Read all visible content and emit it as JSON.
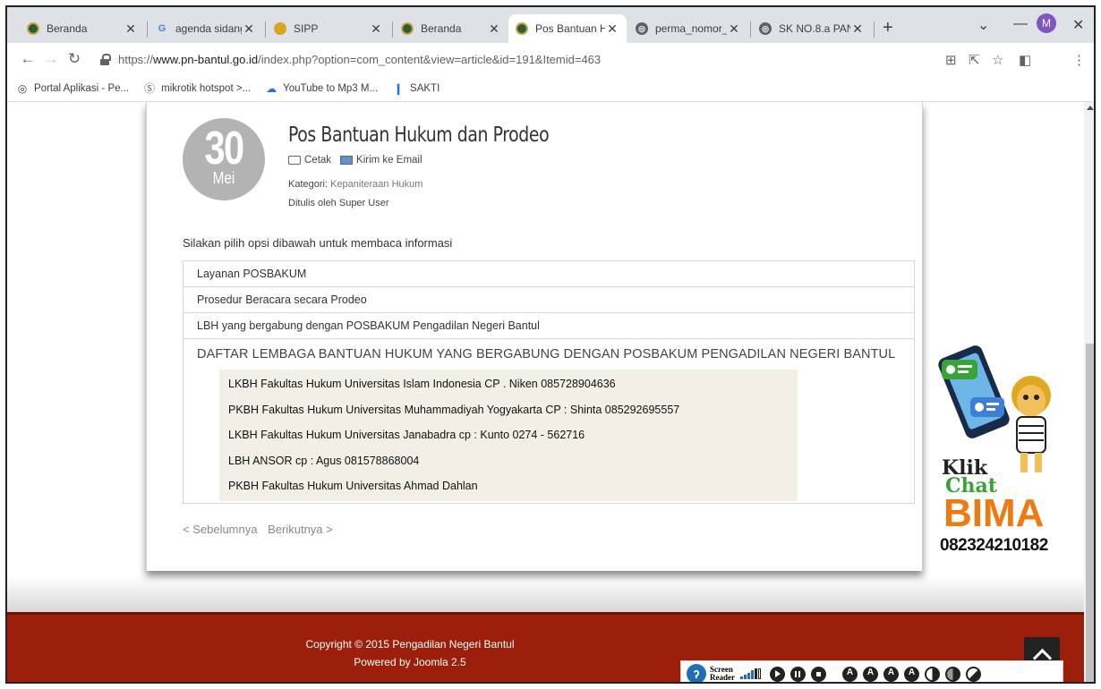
{
  "browser": {
    "tabs": [
      {
        "title": "Beranda",
        "favicon": "court-logo-icon"
      },
      {
        "title": "agenda sidang",
        "favicon": "google-icon"
      },
      {
        "title": "SIPP",
        "favicon": "sipp-logo-icon"
      },
      {
        "title": "Beranda",
        "favicon": "court-logo-icon"
      },
      {
        "title": "Pos Bantuan H",
        "favicon": "court-logo-icon",
        "active": true
      },
      {
        "title": "perma_nomor_",
        "favicon": "globe-icon"
      },
      {
        "title": "SK NO.8.a PAN",
        "favicon": "globe-icon"
      }
    ],
    "url_scheme": "https://",
    "url_host": "www.pn-bantul.go.id",
    "url_path": "/index.php?option=com_content&view=article&id=191&Itemid=463",
    "profile_initial": "M",
    "bookmarks": [
      {
        "label": "Portal Aplikasi - Pe...",
        "icon": "globe-icon"
      },
      {
        "label": "mikrotik hotspot >...",
        "icon": "mikrotik-icon"
      },
      {
        "label": "YouTube to Mp3 M...",
        "icon": "cloud-download-icon"
      },
      {
        "label": "SAKTI",
        "icon": "sakti-icon"
      }
    ]
  },
  "article": {
    "date_day": "30",
    "date_month": "Mei",
    "title": "Pos Bantuan Hukum dan Prodeo",
    "print_label": "Cetak",
    "email_label": "Kirim ke Email",
    "category_label": "Kategori:",
    "category_value": "Kepaniteraan Hukum",
    "author_text": "Ditulis oleh Super User",
    "intro": "Silakan pilih opsi dibawah untuk membaca informasi",
    "accordion": [
      "Layanan POSBAKUM",
      "Prosedur Beracara secara Prodeo",
      "LBH yang bergabung dengan POSBAKUM Pengadilan Negeri Bantul"
    ],
    "open_section_title": "DAFTAR LEMBAGA BANTUAN HUKUM YANG BERGABUNG DENGAN POSBAKUM PENGADILAN NEGERI BANTUL",
    "open_section_items": [
      "LKBH Fakultas Hukum Universitas Islam Indonesia CP . Niken 085728904636",
      "PKBH Fakultas Hukum Universitas Muhammadiyah Yogyakarta CP : Shinta 085292695557",
      "LKBH Fakultas Hukum Universitas Janabadra cp : Kunto 0274 - 562716",
      "LBH ANSOR cp : Agus 081578868004",
      "PKBH Fakultas Hukum Universitas Ahmad Dahlan"
    ],
    "prev_label": "< Sebelumnya",
    "next_label": "Berikutnya >"
  },
  "footer": {
    "copyright": "Copyright © 2015 Pengadilan Negeri Bantul",
    "powered": "Powered by Joomla 2.5"
  },
  "chat_widget": {
    "line1": "Klik",
    "line2": "Chat",
    "line3": "BIMA",
    "phone": "082324210182"
  },
  "screen_reader": {
    "label": "Screen Reader"
  },
  "colors": {
    "footer_bg": "#9b1f0a",
    "chat_green": "#3aa335",
    "bima_orange": "#f07a12"
  }
}
